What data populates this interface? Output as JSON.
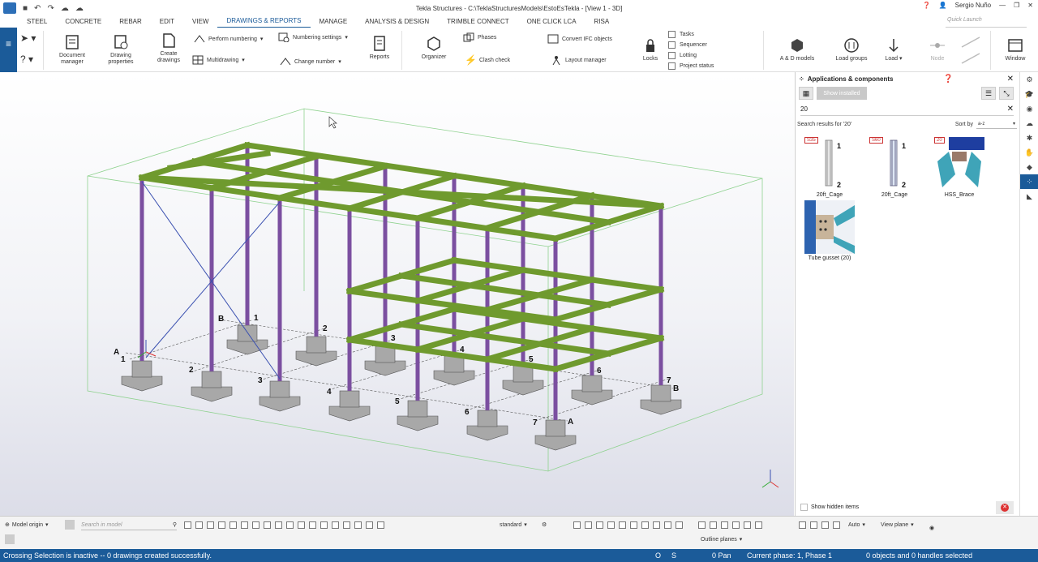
{
  "window": {
    "title": "Tekla Structures - C:\\TeklaStructuresModels\\EstoEsTekla - [View 1 - 3D]",
    "user": "Sergio Nuño"
  },
  "menu": {
    "tabs": [
      "STEEL",
      "CONCRETE",
      "REBAR",
      "EDIT",
      "VIEW",
      "DRAWINGS & REPORTS",
      "MANAGE",
      "ANALYSIS & DESIGN",
      "TRIMBLE CONNECT",
      "ONE CLICK LCA",
      "RISA"
    ],
    "active": "DRAWINGS & REPORTS",
    "quick_launch_placeholder": "Quick Launch"
  },
  "ribbon": {
    "document_manager": "Document manager",
    "drawing_properties": "Drawing properties",
    "create_drawings": "Create drawings",
    "perform_numbering": "Perform numbering",
    "numbering_settings": "Numbering settings",
    "multidrawing": "Multidrawing",
    "change_number": "Change number",
    "reports": "Reports",
    "organizer": "Organizer",
    "phases": "Phases",
    "clash_check": "Clash check",
    "convert_ifc": "Convert IFC objects",
    "layout_manager": "Layout manager",
    "locks": "Locks",
    "tasks": "Tasks",
    "sequencer": "Sequencer",
    "lotting": "Lotting",
    "project_status": "Project status",
    "ad_models": "A & D models",
    "load_groups": "Load groups",
    "load": "Load",
    "node": "Node",
    "window": "Window"
  },
  "grid_labels": {
    "a": "A",
    "b": "B",
    "n1": "1",
    "n2": "2",
    "n3": "3",
    "n4": "4",
    "n5": "5",
    "n6": "6",
    "n7": "7"
  },
  "panel": {
    "title": "Applications & components",
    "show_installed": "Show installed",
    "search_value": "20",
    "results_label": "Search results for '20'",
    "sort_by": "Sort by",
    "sort_value": "a-z",
    "components": [
      {
        "name": "20ft_Cage",
        "tag": "S35"
      },
      {
        "name": "20ft_Cage",
        "tag": "S60"
      },
      {
        "name": "HSS_Brace",
        "tag": "20"
      },
      {
        "name": "Tube gusset (20)",
        "tag": ""
      }
    ],
    "show_hidden": "Show hidden items"
  },
  "toolbar": {
    "model_origin": "Model origin",
    "search_placeholder": "Search in model",
    "standard": "standard",
    "auto": "Auto",
    "view_plane": "View plane",
    "outline_planes": "Outline planes"
  },
  "status": {
    "message": "Crossing Selection is inactive -- 0 drawings created successfully.",
    "o": "O",
    "s": "S",
    "pan": "0 Pan",
    "phase": "Current phase: 1, Phase 1",
    "selection": "0 objects and 0 handles selected"
  },
  "colors": {
    "accent": "#1b5b99",
    "beam": "#7aa33a",
    "column": "#7b4fa0"
  }
}
